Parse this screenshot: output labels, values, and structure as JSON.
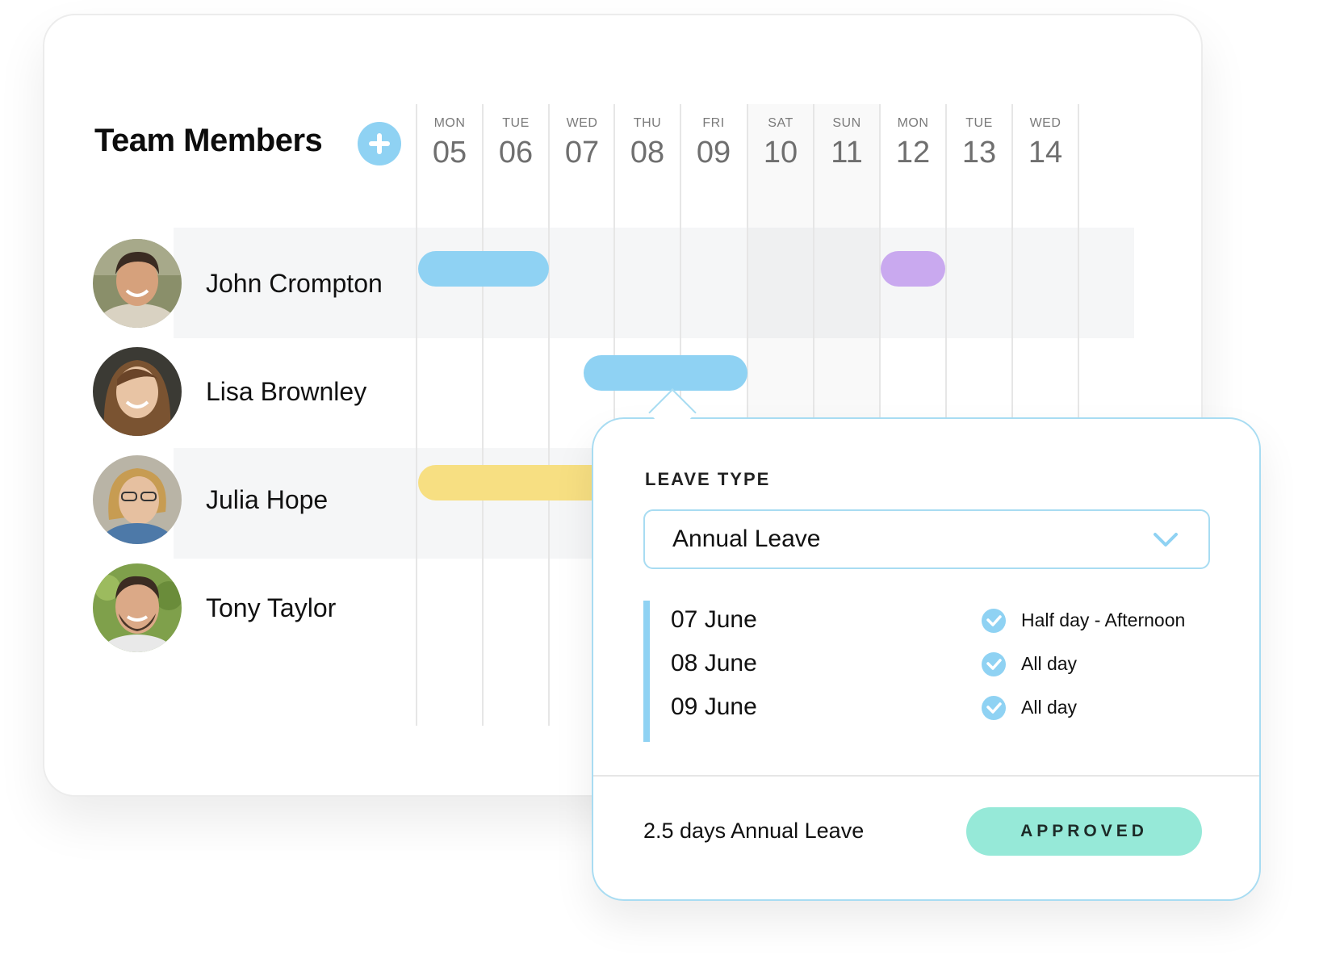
{
  "header": {
    "title": "Team Members"
  },
  "days": [
    {
      "name": "MON",
      "num": "05"
    },
    {
      "name": "TUE",
      "num": "06"
    },
    {
      "name": "WED",
      "num": "07"
    },
    {
      "name": "THU",
      "num": "08"
    },
    {
      "name": "FRI",
      "num": "09"
    },
    {
      "name": "SAT",
      "num": "10"
    },
    {
      "name": "SUN",
      "num": "11"
    },
    {
      "name": "MON",
      "num": "12"
    },
    {
      "name": "TUE",
      "num": "13"
    },
    {
      "name": "WED",
      "num": "14"
    }
  ],
  "members": [
    {
      "name": "John Crompton"
    },
    {
      "name": "Lisa Brownley"
    },
    {
      "name": "Julia Hope"
    },
    {
      "name": "Tony Taylor"
    }
  ],
  "colors": {
    "accent": "#8fd2f3",
    "annual_leave": "#8fd2f3",
    "other_leave": "#c9a9ef",
    "sick_leave": "#f7df82",
    "approved": "#96e9d8"
  },
  "popup": {
    "label": "LEAVE TYPE",
    "leave_type": "Annual Leave",
    "entries": [
      {
        "date": "07 June",
        "duration": "Half day - Afternoon"
      },
      {
        "date": "08 June",
        "duration": "All day"
      },
      {
        "date": "09 June",
        "duration": "All day"
      }
    ],
    "summary": "2.5 days Annual Leave",
    "status": "APPROVED"
  }
}
